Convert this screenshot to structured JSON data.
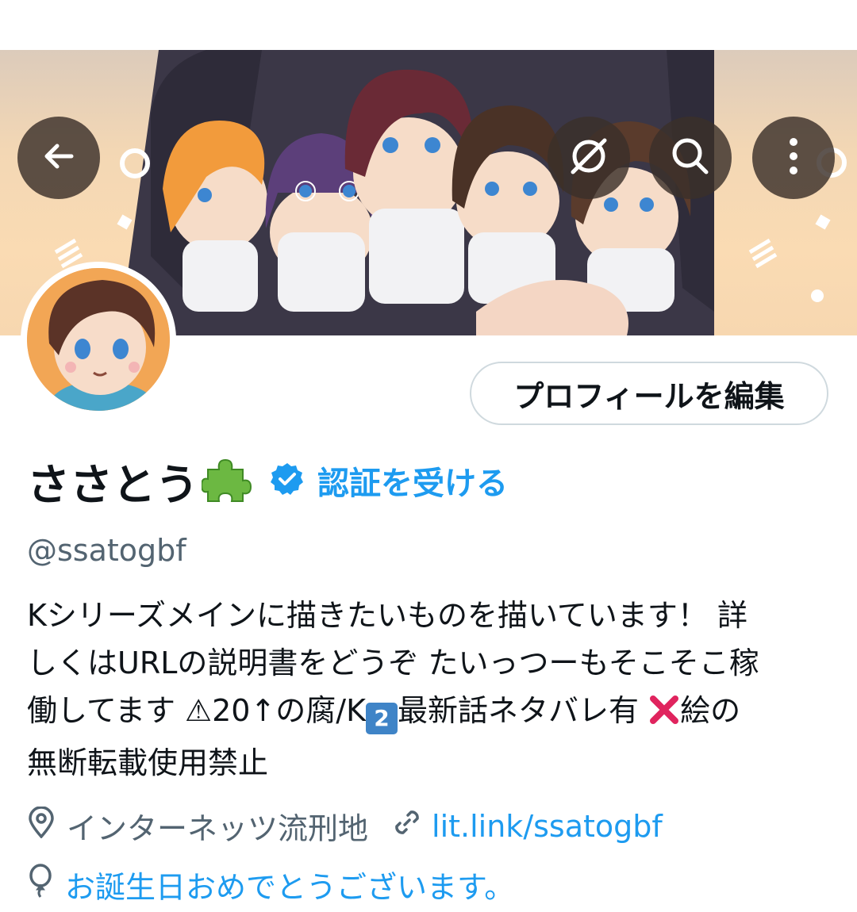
{
  "header": {
    "back_icon": "arrow-left-icon",
    "grok_icon": "grok-slash-circle-icon",
    "search_icon": "search-icon",
    "more_icon": "vertical-ellipsis-icon"
  },
  "profile": {
    "edit_button_label": "プロフィールを編集",
    "display_name": "ささとう",
    "name_emoji": "puzzle-piece-icon",
    "verify_link": "認証を受ける",
    "handle": "@ssatogbf",
    "bio_lines": [
      "Kシリーズメインに描きたいものを描いています！ 詳",
      "しくはURLの説明書をどうぞ たいっつーもそこそこ稼",
      "働してます ⚠20↑の腐/K",
      "2",
      "最新話ネタバレ有 ",
      "絵の",
      "無断転載使用禁止"
    ],
    "location": "インターネッツ流刑地",
    "website": "lit.link/ssatogbf",
    "birthday_text": "お誕生日おめでとうございます。"
  },
  "colors": {
    "link": "#1d9bf0",
    "secondary_text": "#536471",
    "primary_text": "#0f1419",
    "border": "#cfd9de"
  }
}
